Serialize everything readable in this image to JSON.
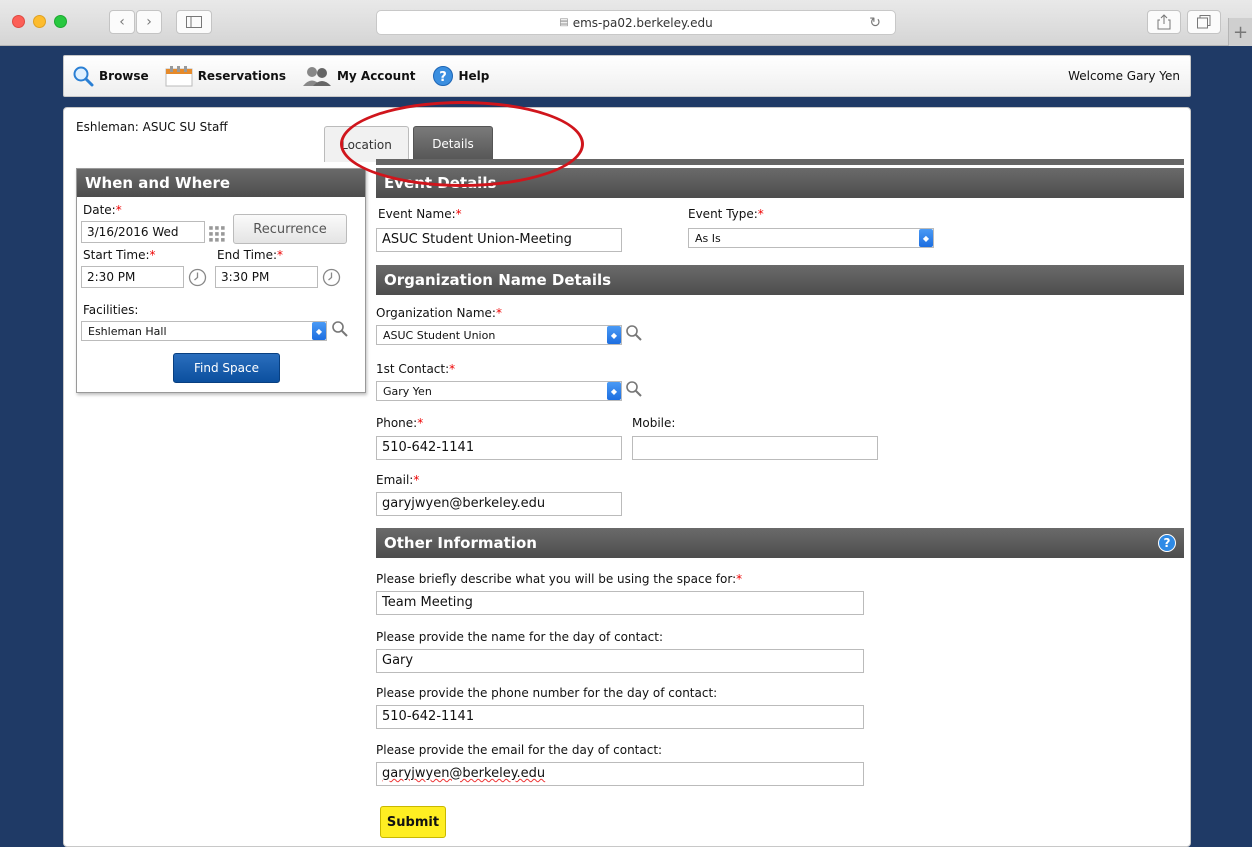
{
  "browser": {
    "url": "ems-pa02.berkeley.edu"
  },
  "nav": {
    "browse": "Browse",
    "reservations": "Reservations",
    "account": "My Account",
    "help": "Help",
    "welcome": "Welcome Gary Yen"
  },
  "context_title": "Eshleman: ASUC SU Staff",
  "when_where": {
    "title": "When and Where",
    "date_label": "Date:",
    "date_value": "3/16/2016 Wed",
    "recurrence": "Recurrence",
    "start_label": "Start Time:",
    "start_value": "2:30 PM",
    "end_label": "End Time:",
    "end_value": "3:30 PM",
    "facilities_label": "Facilities:",
    "facilities_value": "Eshleman Hall",
    "find_space": "Find Space"
  },
  "tabs": {
    "location": "Location",
    "details": "Details"
  },
  "event_details": {
    "title": "Event Details",
    "name_label": "Event Name:",
    "name_value": "ASUC Student Union-Meeting",
    "type_label": "Event Type:",
    "type_value": "As Is"
  },
  "org": {
    "title": "Organization Name Details",
    "org_label": "Organization Name:",
    "org_value": "ASUC Student Union",
    "contact_label": "1st Contact:",
    "contact_value": "Gary Yen",
    "phone_label": "Phone:",
    "phone_value": "510-642-1141",
    "mobile_label": "Mobile:",
    "mobile_value": "",
    "email_label": "Email:",
    "email_value": "garyjwyen@berkeley.edu"
  },
  "other": {
    "title": "Other Information",
    "q1_label": "Please briefly describe what you will be using the space for:",
    "q1_value": "Team Meeting",
    "q2_label": "Please provide the name for the day of contact:",
    "q2_value": "Gary",
    "q3_label": "Please provide the phone number for the day of contact:",
    "q3_value": "510-642-1141",
    "q4_label": "Please provide the email for the day of contact:",
    "q4_value": "garyjwyen@berkeley.edu"
  },
  "submit": "Submit",
  "required_mark": "*",
  "help_glyph": "?"
}
